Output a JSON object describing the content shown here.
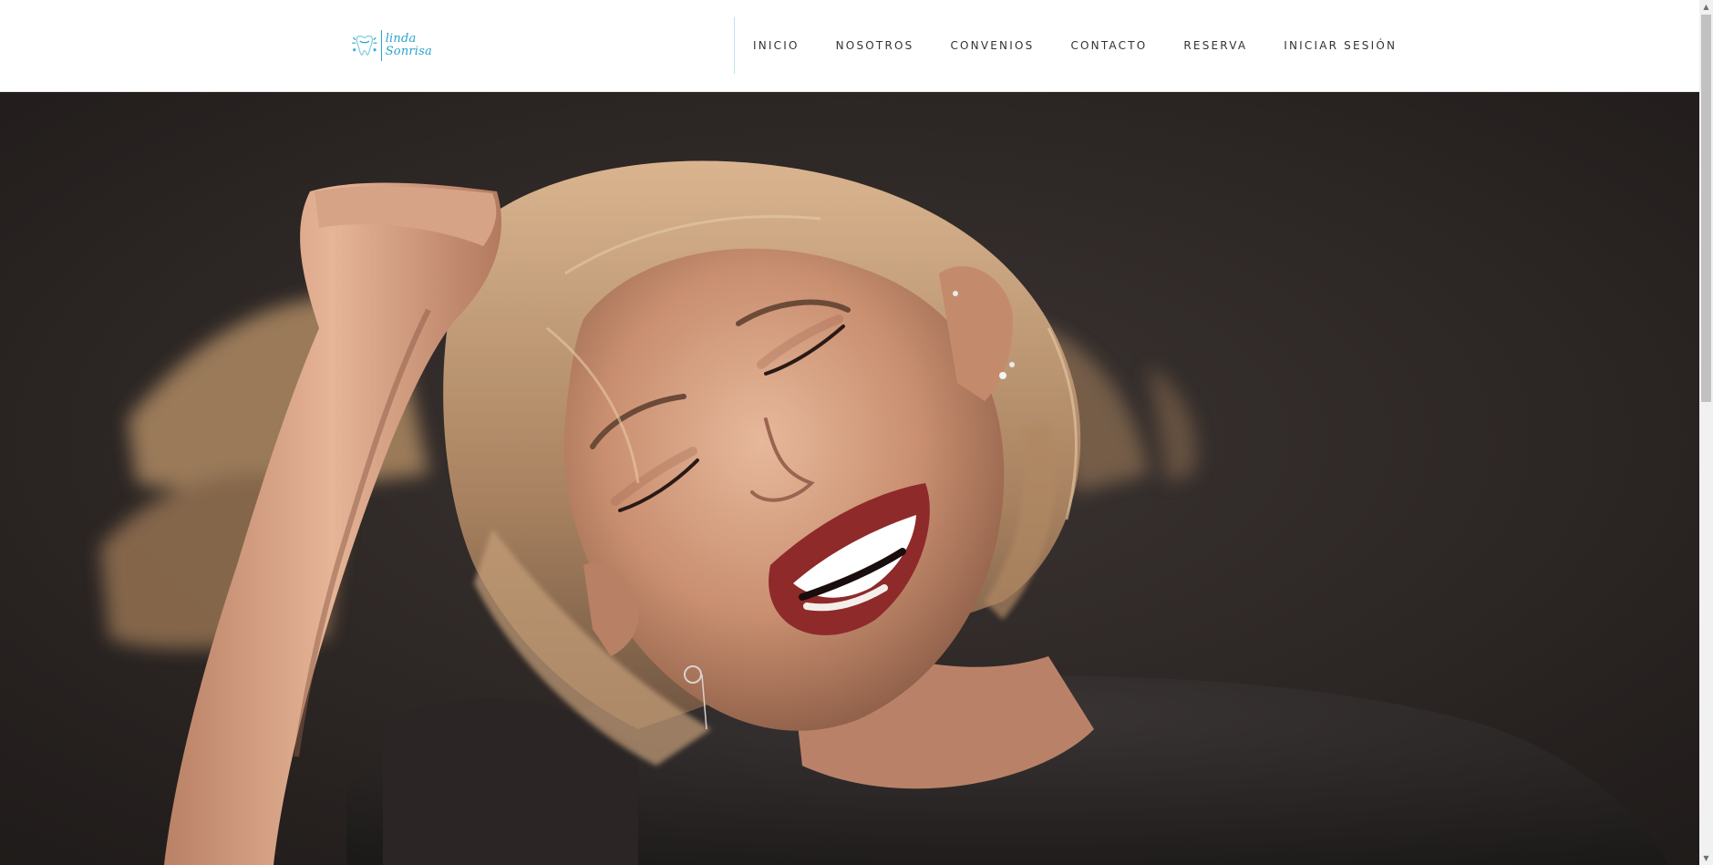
{
  "brand": {
    "name_line1": "linda",
    "name_line2": "Sonrisa",
    "logo_icon": "tooth-icon",
    "accent_color": "#2aa3c9"
  },
  "nav": {
    "items": [
      {
        "label": "INICIO"
      },
      {
        "label": "NOSOTROS"
      },
      {
        "label": "CONVENIOS"
      },
      {
        "label": "CONTACTO"
      },
      {
        "label": "RESERVA"
      },
      {
        "label": "INICIAR SESIÓN"
      }
    ]
  },
  "hero": {
    "image_subject": "hero-photo",
    "background_color": "#2a2523"
  },
  "scrollbar": {
    "up_icon": "scroll-up-arrow-icon",
    "down_icon": "scroll-down-arrow-icon"
  }
}
